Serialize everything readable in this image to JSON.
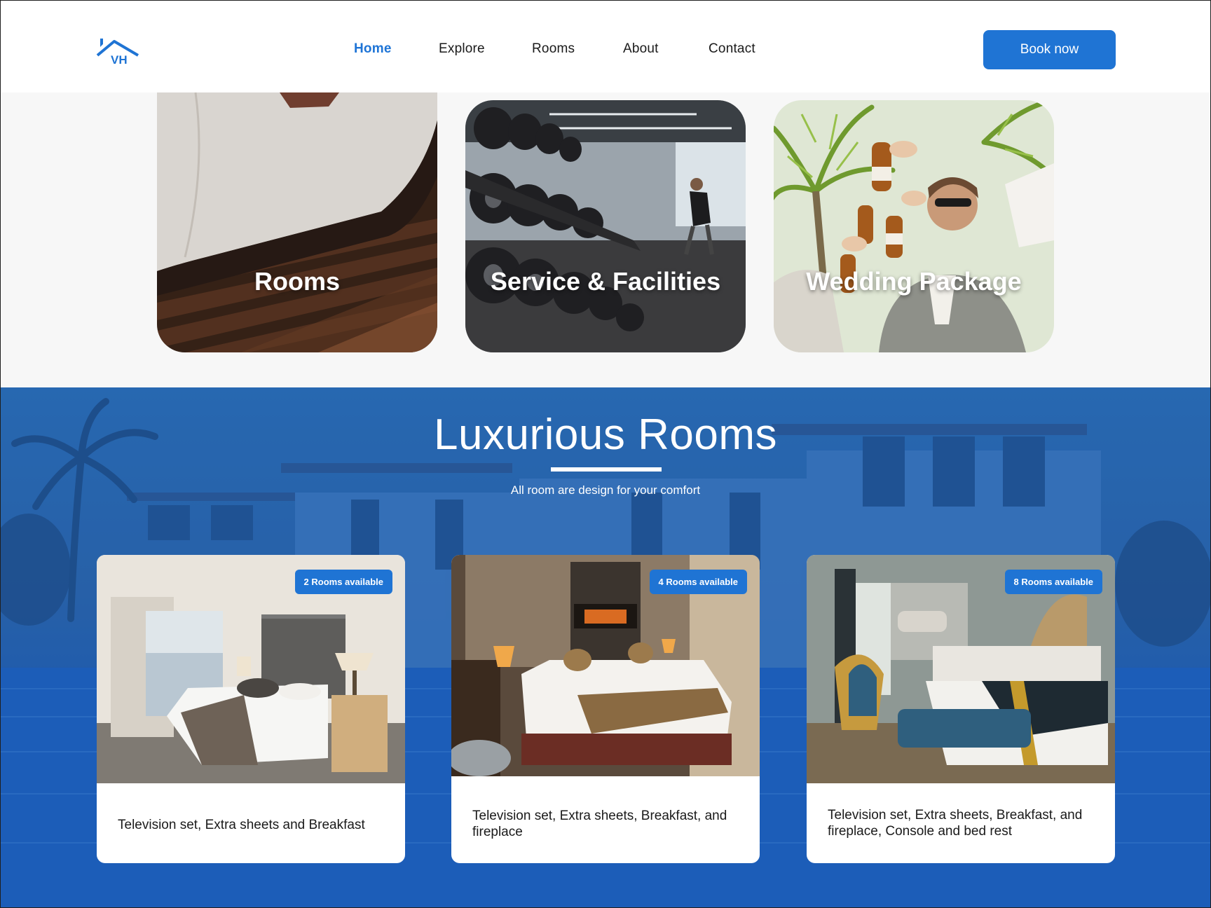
{
  "header": {
    "logo_text": "VH",
    "nav": [
      "Home",
      "Explore",
      "Rooms",
      "About",
      "Contact"
    ],
    "active_nav": "Home",
    "book_button": "Book now"
  },
  "categories": [
    {
      "label": "Rooms"
    },
    {
      "label": "Service & Facilities"
    },
    {
      "label": "Wedding Package"
    }
  ],
  "rooms_section": {
    "title": "Luxurious Rooms",
    "subtitle": "All room are design for your comfort",
    "rooms": [
      {
        "badge": "2 Rooms available",
        "description": "Television set, Extra sheets and Breakfast"
      },
      {
        "badge": "4 Rooms available",
        "description": "Television set, Extra sheets, Breakfast, and fireplace"
      },
      {
        "badge": "8 Rooms available",
        "description": "Television set, Extra sheets, Breakfast, and fireplace, Console and bed rest"
      }
    ]
  },
  "colors": {
    "accent": "#1f74d4",
    "section_blue": "#2a64ad",
    "text_dark": "#1a1a1a"
  }
}
